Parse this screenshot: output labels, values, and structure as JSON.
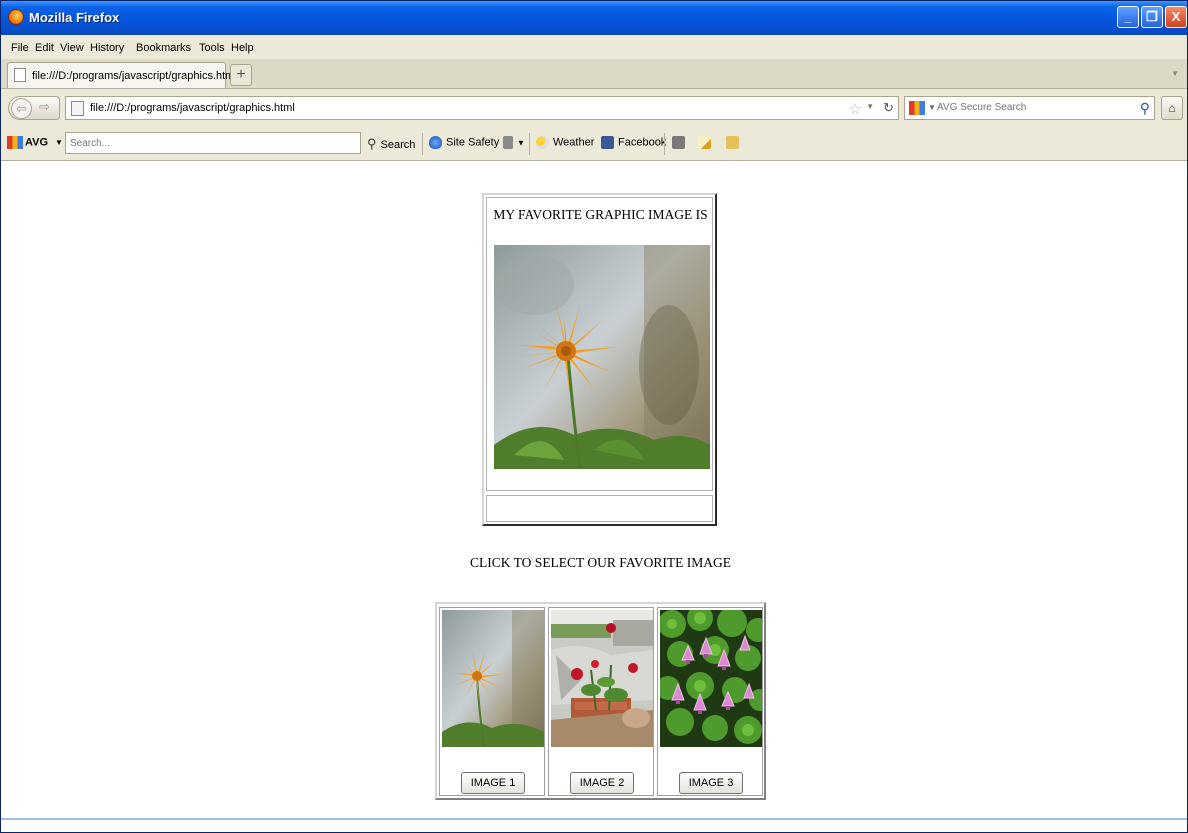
{
  "window": {
    "title": "Mozilla Firefox",
    "buttons": {
      "minimize": "_",
      "maximize": "❐",
      "close": "X"
    }
  },
  "menu": {
    "items": [
      "File",
      "Edit",
      "View",
      "History",
      "Bookmarks",
      "Tools",
      "Help"
    ]
  },
  "tabs": {
    "active_tab_label": "file:///D:/programs/javascript/graphics.html",
    "new_tab_symbol": "+"
  },
  "navbar": {
    "url": "file:///D:/programs/javascript/graphics.html",
    "search_placeholder": "AVG Secure Search"
  },
  "avg_toolbar": {
    "brand": "AVG",
    "search_placeholder": "Search...",
    "search_label": "Search",
    "site_safety_label": "Site Safety",
    "weather_label": "Weather",
    "facebook_label": "Facebook"
  },
  "page": {
    "favorite_heading": "MY FAVORITE GRAPHIC IMAGE IS",
    "select_prompt": "CLICK TO SELECT OUR FAVORITE IMAGE",
    "image_buttons": [
      "IMAGE 1",
      "IMAGE 2",
      "IMAGE 3"
    ]
  },
  "colors": {
    "titlebar": "#0556dd",
    "chrome": "#ece9d8",
    "flower_orange": "#f5a11a"
  }
}
